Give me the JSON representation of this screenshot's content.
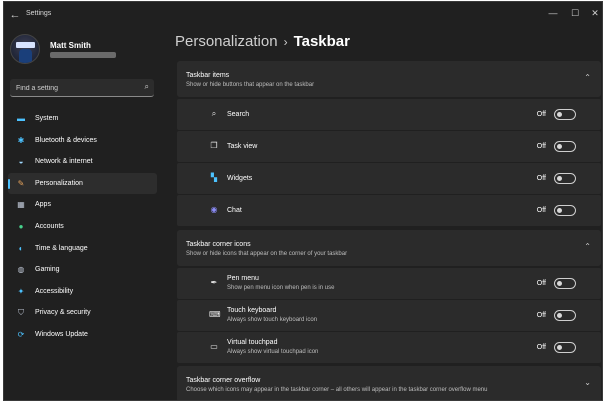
{
  "window": {
    "title": "Settings"
  },
  "profile": {
    "name": "Matt Smith"
  },
  "search": {
    "placeholder": "Find a setting"
  },
  "sidebar": {
    "items": [
      {
        "label": "System",
        "icon": "monitor-icon",
        "color": "#4cc2ff",
        "glyph": "▬"
      },
      {
        "label": "Bluetooth & devices",
        "icon": "bluetooth-icon",
        "color": "#4cc2ff",
        "glyph": "✱"
      },
      {
        "label": "Network & internet",
        "icon": "wifi-icon",
        "color": "#9fd8ff",
        "glyph": "◒"
      },
      {
        "label": "Personalization",
        "icon": "brush-icon",
        "color": "#e6a35c",
        "glyph": "✎",
        "active": true
      },
      {
        "label": "Apps",
        "icon": "apps-icon",
        "color": "#bfc7d6",
        "glyph": "▦"
      },
      {
        "label": "Accounts",
        "icon": "person-icon",
        "color": "#47d18c",
        "glyph": "●"
      },
      {
        "label": "Time & language",
        "icon": "globe-clock-icon",
        "color": "#4cc2ff",
        "glyph": "◐"
      },
      {
        "label": "Gaming",
        "icon": "gamepad-icon",
        "color": "#bfc7d6",
        "glyph": "◍"
      },
      {
        "label": "Accessibility",
        "icon": "accessibility-icon",
        "color": "#4cc2ff",
        "glyph": "✦"
      },
      {
        "label": "Privacy & security",
        "icon": "shield-icon",
        "color": "#bfc7d6",
        "glyph": "⛉"
      },
      {
        "label": "Windows Update",
        "icon": "update-icon",
        "color": "#4cc2ff",
        "glyph": "⟳"
      }
    ]
  },
  "breadcrumb": {
    "parent": "Personalization",
    "separator": "›",
    "current": "Taskbar"
  },
  "sections": {
    "taskbar_items": {
      "title": "Taskbar items",
      "subtitle": "Show or hide buttons that appear on the taskbar",
      "rows": [
        {
          "label": "Search",
          "state": "Off",
          "icon": "search-icon"
        },
        {
          "label": "Task view",
          "state": "Off",
          "icon": "task-view-icon"
        },
        {
          "label": "Widgets",
          "state": "Off",
          "icon": "widgets-icon"
        },
        {
          "label": "Chat",
          "state": "Off",
          "icon": "chat-icon"
        }
      ]
    },
    "corner_icons": {
      "title": "Taskbar corner icons",
      "subtitle": "Show or hide icons that appear on the corner of your taskbar",
      "rows": [
        {
          "label": "Pen menu",
          "sub": "Show pen menu icon when pen is in use",
          "state": "Off",
          "icon": "pen-icon"
        },
        {
          "label": "Touch keyboard",
          "sub": "Always show touch keyboard icon",
          "state": "Off",
          "icon": "keyboard-icon"
        },
        {
          "label": "Virtual touchpad",
          "sub": "Always show virtual touchpad icon",
          "state": "Off",
          "icon": "touchpad-icon"
        }
      ]
    },
    "corner_overflow": {
      "title": "Taskbar corner overflow",
      "subtitle": "Choose which icons may appear in the taskbar corner – all others will appear in the taskbar corner overflow menu"
    }
  },
  "colors": {
    "background": "#202020",
    "card": "#2b2b2b",
    "accent": "#4cc2ff"
  }
}
